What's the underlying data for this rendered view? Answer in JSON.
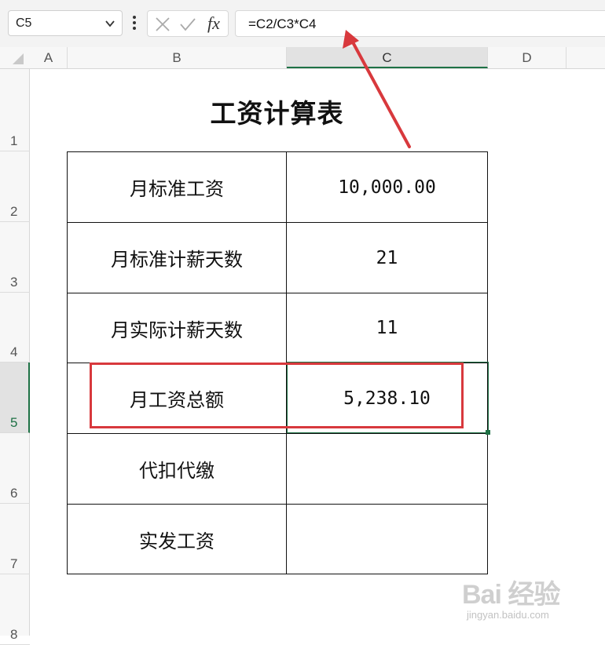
{
  "formula_bar": {
    "name_box": "C5",
    "cancel_icon": "close-x-icon",
    "confirm_icon": "checkmark-icon",
    "function_label": "fx",
    "formula": "=C2/C3*C4"
  },
  "columns": [
    "A",
    "B",
    "C",
    "D"
  ],
  "rows": [
    "1",
    "2",
    "3",
    "4",
    "5",
    "6",
    "7",
    "8"
  ],
  "active_cell": "C5",
  "sheet": {
    "title": "工资计算表",
    "table": [
      {
        "label": "月标准工资",
        "value": "10,000.00"
      },
      {
        "label": "月标准计薪天数",
        "value": "21"
      },
      {
        "label": "月实际计薪天数",
        "value": "11"
      },
      {
        "label": "月工资总额",
        "value": "5,238.10"
      },
      {
        "label": "代扣代缴",
        "value": ""
      },
      {
        "label": "实发工资",
        "value": ""
      }
    ]
  },
  "annotation": {
    "color": "#d8393d"
  },
  "watermark": {
    "brand": "Bai 经验",
    "site": "jingyan.baidu.com"
  },
  "colors": {
    "accent": "#1e7145",
    "annotation_red": "#d8393d"
  }
}
